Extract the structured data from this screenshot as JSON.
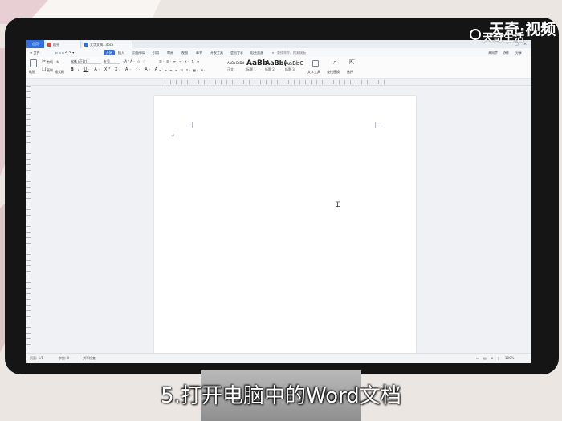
{
  "caption": "5.打开电脑中的Word文档",
  "watermark": {
    "brand_large": "天奇·视频",
    "brand_small": "天奇生活",
    "logo_icon": "tianqi-logo-icon"
  },
  "app": {
    "home_tab": "首页",
    "tabs": [
      {
        "label": "稻壳",
        "icon": "daoke-icon"
      },
      {
        "label": "文字文稿1.docx",
        "icon": "doc-icon"
      }
    ],
    "window_controls": [
      "-",
      "□",
      "×"
    ]
  },
  "menu": {
    "file": "≡ 文件",
    "items": [
      "开始",
      "插入",
      "页面布局",
      "引用",
      "审阅",
      "视图",
      "章节",
      "开发工具",
      "会员专享",
      "稻壳资源"
    ],
    "active": "开始",
    "search": "查找命令、搜索模板",
    "right_items": [
      "未同步",
      "协作",
      "分享"
    ]
  },
  "ribbon": {
    "paste": "粘贴",
    "cut": "剪切",
    "copy": "复制",
    "format_painter": "格式刷",
    "font_name": "宋体 (正文)",
    "font_size": "五号",
    "styles": [
      {
        "sample": "AaBbCcDd",
        "name": "正文"
      },
      {
        "sample": "AaBb",
        "name": "标题 1"
      },
      {
        "sample": "AaBb(",
        "name": "标题 2"
      },
      {
        "sample": "AaBbC",
        "name": "标题 3"
      }
    ],
    "text_tools": "文字工具",
    "find_replace": "查找替换",
    "select": "选择"
  },
  "status": {
    "page": "页面: 1/1",
    "words": "字数: 0",
    "spell": "拼写检查",
    "zoom": "100%"
  },
  "colors": {
    "accent": "#2f6fde",
    "monitor_bezel": "#151515",
    "page_background": "#ffffff",
    "workspace": "#eff1f4"
  }
}
